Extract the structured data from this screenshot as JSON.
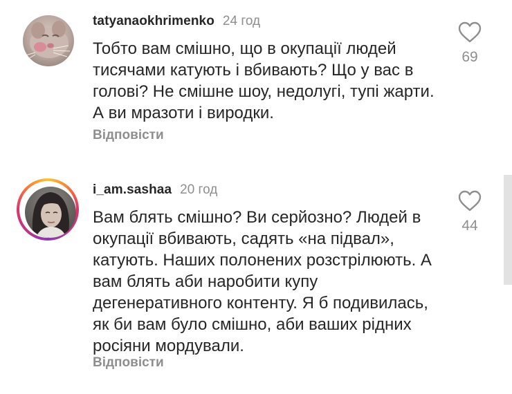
{
  "comments": [
    {
      "username": "tatyanaokhrimenko",
      "timestamp": "24 год",
      "text": "Тобто вам смішно, що в окупації людей тисячами катують і вбивають? Що у вас в голові? Не смішне шоу, недолугі, тупі жарти. А ви мразоти і виродки.",
      "likes": "69",
      "reply_label": "Відповісти",
      "avatar_icon": "cat-photo-avatar"
    },
    {
      "username": "i_am.sashaa",
      "timestamp": "20 год",
      "text": "Вам блять смішно? Ви серйозно? Людей в окупації вбивають, садять «на підвал», катують. Наших полонених розстрілюють. А вам блять аби наробити купу дегенеративного контенту. Я б подивилась, як би вам було смішно, аби ваших рідних росіяни мордували.",
      "likes": "44",
      "reply_label": "Відповісти",
      "avatar_icon": "woman-photo-avatar",
      "has_story_ring": true
    }
  ],
  "colors": {
    "text_primary": "#262626",
    "text_secondary": "#8e8e8e",
    "story_ring": [
      "#f9c531",
      "#f77737",
      "#e1306c",
      "#c13584",
      "#833ab4"
    ]
  },
  "icons": {
    "like": "heart-outline-icon"
  }
}
